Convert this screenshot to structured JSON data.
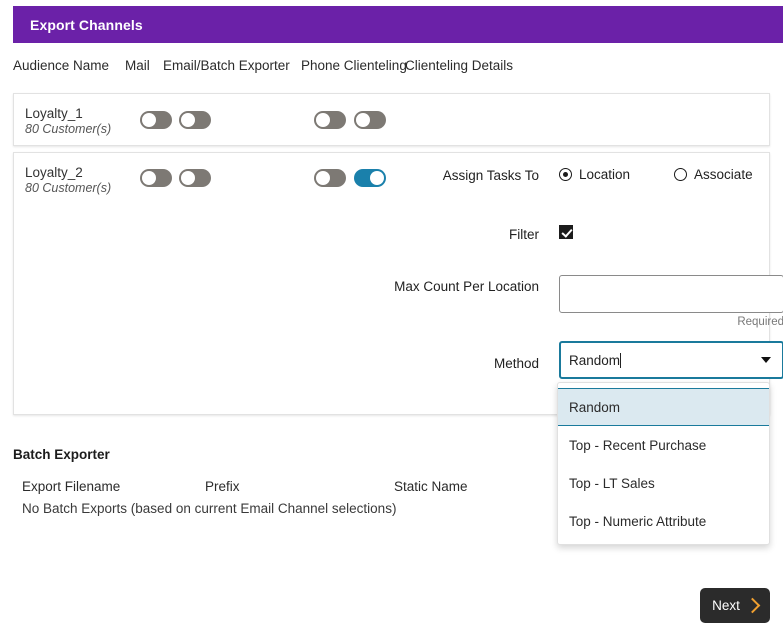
{
  "header": {
    "title": "Export Channels",
    "bar_color": "#6b21a8"
  },
  "columns": {
    "audience_name": "Audience Name",
    "mail": "Mail",
    "email_batch_exporter": "Email/Batch Exporter",
    "phone_clienteling": "Phone Clienteling",
    "clienteling_details": "Clienteling Details"
  },
  "rows": [
    {
      "name": "Loyalty_1",
      "count": "80 Customer(s)",
      "toggles": [
        {
          "name": "mail-toggle",
          "on": false
        },
        {
          "name": "email-batch-exporter-toggle",
          "on": false
        },
        {
          "name": "phone-clienteling-toggle",
          "on": false
        },
        {
          "name": "clienteling-details-toggle",
          "on": false
        }
      ]
    },
    {
      "name": "Loyalty_2",
      "count": "80 Customer(s)",
      "toggles": [
        {
          "name": "mail-toggle",
          "on": false
        },
        {
          "name": "email-batch-exporter-toggle",
          "on": false
        },
        {
          "name": "phone-clienteling-toggle",
          "on": false
        },
        {
          "name": "clienteling-details-toggle",
          "on": true
        }
      ]
    }
  ],
  "form": {
    "assign_tasks_label": "Assign Tasks To",
    "assign_options": [
      {
        "label": "Location",
        "selected": true
      },
      {
        "label": "Associate",
        "selected": false
      }
    ],
    "filter_label": "Filter",
    "filter_checked": true,
    "max_count_label": "Max Count Per Location",
    "max_count_value": "",
    "max_count_helper": "Required",
    "method_label": "Method",
    "method_value": "Random",
    "method_options": [
      {
        "label": "Random",
        "highlighted": true
      },
      {
        "label": "Top - Recent Purchase",
        "highlighted": false
      },
      {
        "label": "Top - LT Sales",
        "highlighted": false
      },
      {
        "label": "Top - Numeric Attribute",
        "highlighted": false
      }
    ]
  },
  "batch_exporter": {
    "title": "Batch Exporter",
    "columns": {
      "export_filename": "Export Filename",
      "prefix": "Prefix",
      "static_name": "Static Name"
    },
    "empty_message": "No Batch Exports (based on current Email Channel selections)"
  },
  "footer": {
    "next_label": "Next"
  },
  "colors": {
    "accent_purple": "#6b21a8",
    "toggle_on": "#1a80ab",
    "toggle_off": "#7d7974",
    "focus_teal": "#1a7a9c",
    "highlight_blue": "#dbe9f0",
    "next_button": "#2b2b2b",
    "chevron_orange": "#f0a030"
  }
}
